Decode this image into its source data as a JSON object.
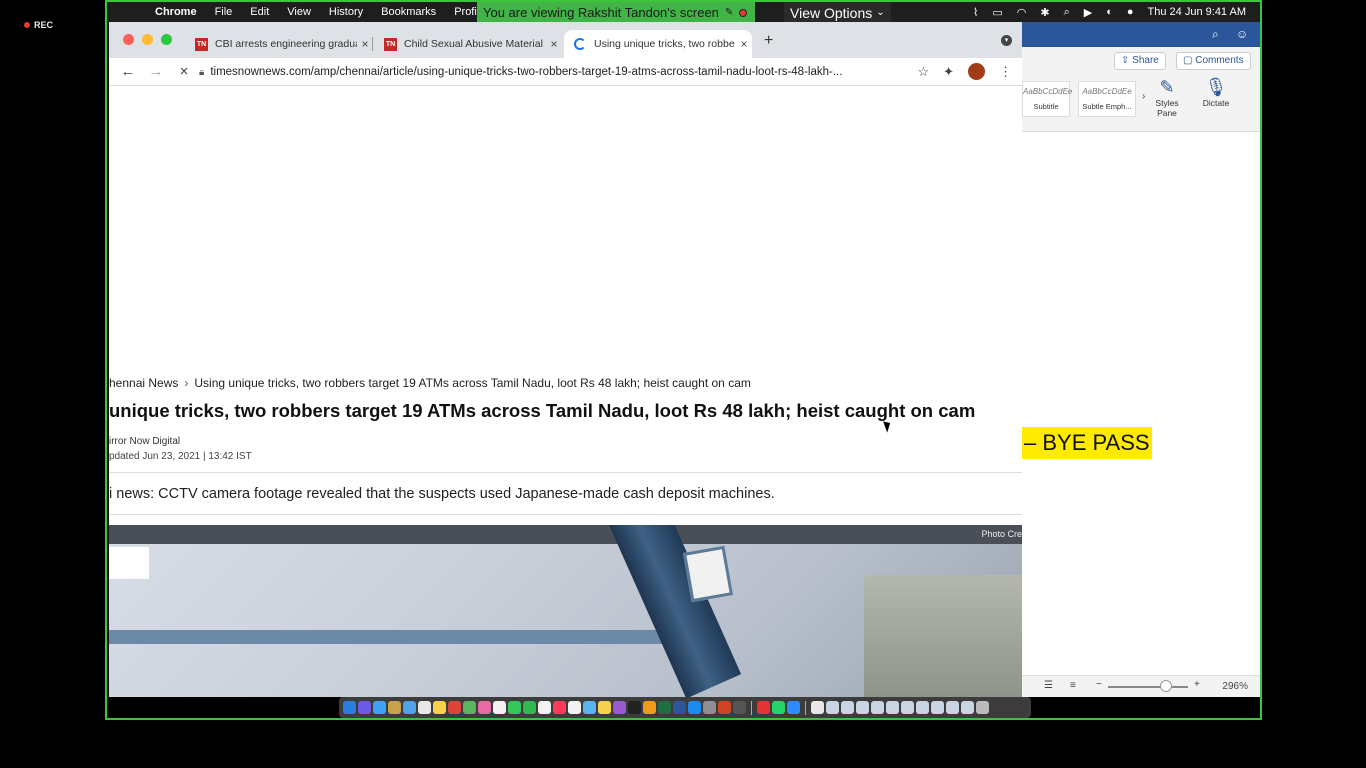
{
  "recording": {
    "label": "REC"
  },
  "menubar": {
    "app_name": "Chrome",
    "items": [
      "File",
      "Edit",
      "View",
      "History",
      "Bookmarks",
      "Profile"
    ],
    "clock": "Thu 24 Jun  9:41 AM"
  },
  "zoom": {
    "banner_text": "You are viewing Rakshit Tandon's screen",
    "view_options_label": "View Options"
  },
  "chrome": {
    "tabs": [
      {
        "title": "CBI arrests engineering gradua",
        "favicon": "TN",
        "active": false
      },
      {
        "title": "Child Sexual Abusive Material",
        "favicon": "TN",
        "active": false
      },
      {
        "title": "Using unique tricks, two robbe",
        "favicon": "loading",
        "active": true
      }
    ],
    "url": "timesnownews.com/amp/chennai/article/using-unique-tricks-two-robbers-target-19-atms-across-tamil-nadu-loot-rs-48-lakh-..."
  },
  "article": {
    "breadcrumb_parent": "hennai News",
    "breadcrumb_current": "Using unique tricks, two robbers target 19 ATMs across Tamil Nadu, loot Rs 48 lakh; heist caught on cam",
    "headline": "unique tricks, two robbers target 19 ATMs across Tamil Nadu, loot Rs 48 lakh; heist caught on cam",
    "byline": "irror Now Digital",
    "updated": "pdated Jun 23, 2021 | 13:42 IST",
    "summary": "i news: CCTV camera footage revealed that the suspects used Japanese-made cash deposit machines.",
    "photo_credit": "Photo Cre"
  },
  "word": {
    "share_label": "Share",
    "comments_label": "Comments",
    "styles": [
      {
        "sample": "AaBbCcDdEe",
        "name": "Subtitle"
      },
      {
        "sample": "AaBbCcDdEe",
        "name": "Subtle Emph..."
      }
    ],
    "styles_pane_label": "Styles Pane",
    "dictate_label": "Dictate",
    "highlight_text": "– BYE PASS",
    "zoom_level": "296%"
  },
  "colors": {
    "share_border": "#3cc43c",
    "zoom_banner": "#41b347",
    "word_blue": "#2b579a",
    "highlight": "#ffeb00"
  }
}
